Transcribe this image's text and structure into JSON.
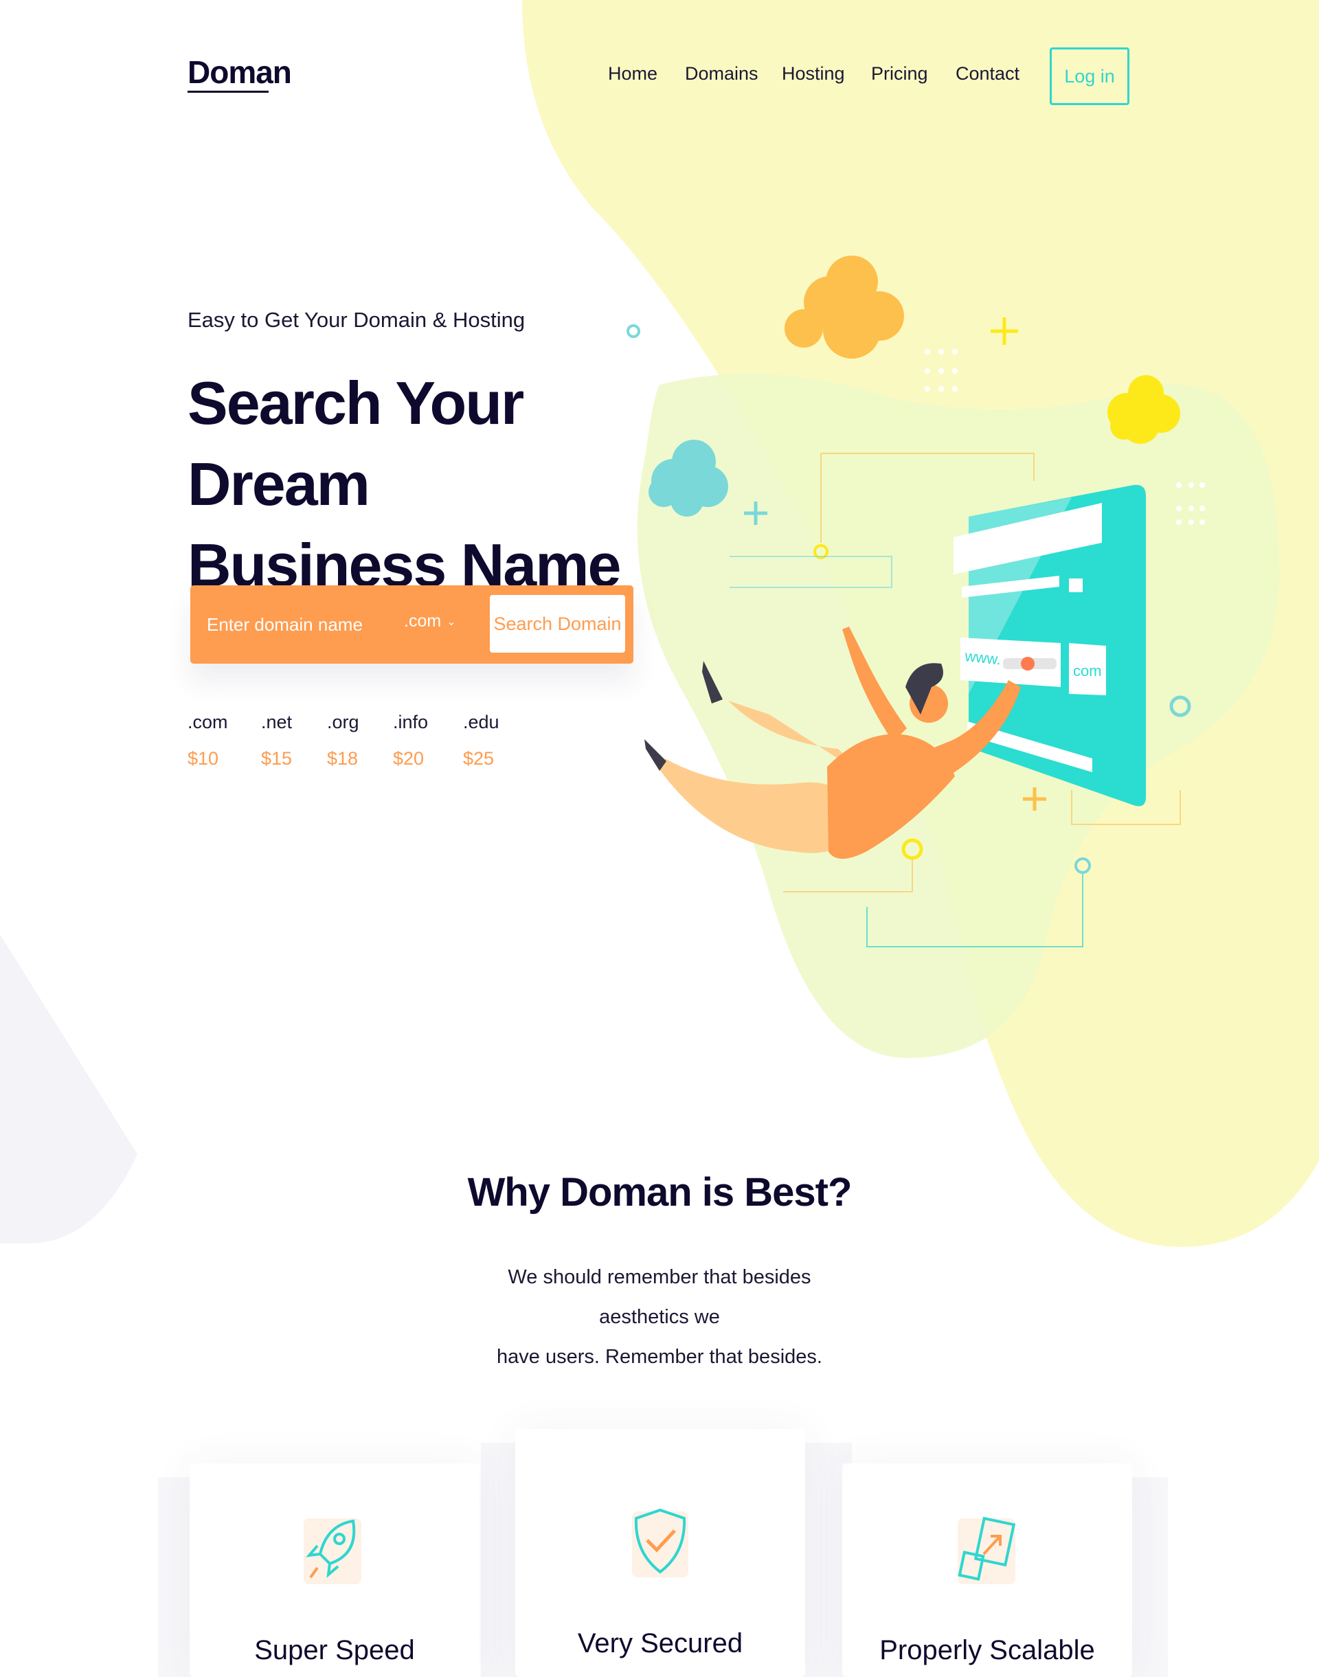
{
  "header": {
    "logo": "Doman",
    "nav": [
      {
        "label": "Home"
      },
      {
        "label": "Domains"
      },
      {
        "label": "Hosting"
      },
      {
        "label": "Pricing"
      },
      {
        "label": "Contact"
      }
    ],
    "login_label": "Log in"
  },
  "hero": {
    "eyebrow": "Easy to Get Your Domain & Hosting",
    "title_line1": "Search Your Dream",
    "title_line2": "Business Name",
    "search": {
      "placeholder": "Enter domain name",
      "value": "",
      "tld_selected": ".com",
      "button_label": "Search Domain"
    },
    "tlds": [
      {
        "name": ".com",
        "price": "$10"
      },
      {
        "name": ".net",
        "price": "$15"
      },
      {
        "name": ".org",
        "price": "$18"
      },
      {
        "name": ".info",
        "price": "$20"
      },
      {
        "name": ".edu",
        "price": "$25"
      }
    ],
    "illustration": {
      "www_label": "www.",
      "com_label": "com"
    }
  },
  "why": {
    "title": "Why Doman is Best?",
    "desc_line1": "We should remember that besides aesthetics we",
    "desc_line2": "have users. Remember that besides."
  },
  "features": [
    {
      "title": "Super Speed",
      "icon": "rocket-icon"
    },
    {
      "title": "Very Secured",
      "icon": "shield-check-icon"
    },
    {
      "title": "Properly Scalable",
      "icon": "scale-arrow-icon"
    }
  ],
  "colors": {
    "accent_orange": "#fe9c4f",
    "accent_teal": "#2fd6cf",
    "dark_text": "#0e0a2e",
    "blob_yellow": "#fbf9c2"
  }
}
